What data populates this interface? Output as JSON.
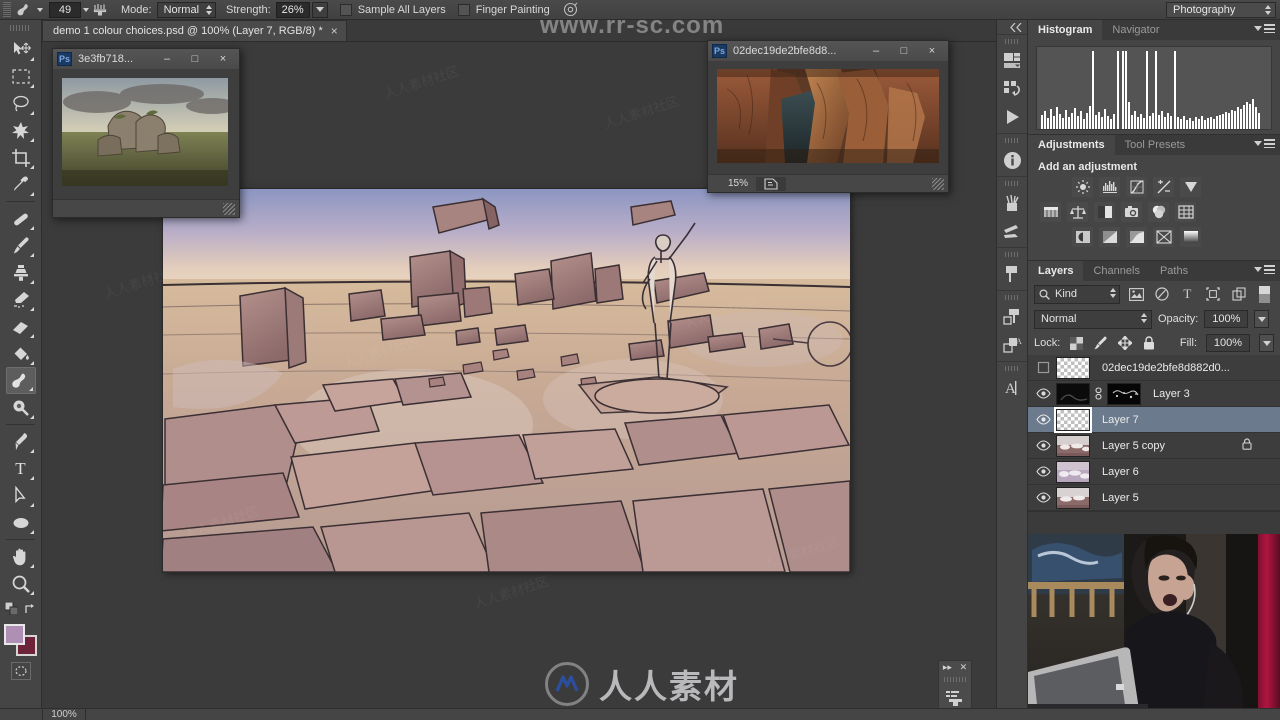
{
  "options_bar": {
    "brush_size": "49",
    "mode_label": "Mode:",
    "mode_value": "Normal",
    "strength_label": "Strength:",
    "strength_value": "26%",
    "sample_all_layers": "Sample All Layers",
    "finger_painting": "Finger Painting",
    "workspace": "Photography",
    "tool_icon": "smudge-tool-icon",
    "brush_preset_icon": "brush-preset-icon",
    "airbrush_icon": "airbrush-icon",
    "pressure_icon": "tablet-pressure-icon"
  },
  "document_tab": {
    "title": "demo 1 colour choices.psd @ 100% (Layer 7, RGB/8) *",
    "close": "×"
  },
  "toolbar": {
    "tools": [
      {
        "name": "move-tool",
        "glyph": "move"
      },
      {
        "name": "marquee-tool",
        "glyph": "marquee"
      },
      {
        "name": "lasso-tool",
        "glyph": "lasso"
      },
      {
        "name": "quick-selection-tool",
        "glyph": "wand"
      },
      {
        "name": "crop-tool",
        "glyph": "crop"
      },
      {
        "name": "eyedropper-tool",
        "glyph": "eyedropper"
      },
      {
        "name": "spot-healing-brush-tool",
        "glyph": "healing"
      },
      {
        "name": "brush-tool",
        "glyph": "brush"
      },
      {
        "name": "clone-stamp-tool",
        "glyph": "stamp"
      },
      {
        "name": "history-brush-tool",
        "glyph": "historybrush"
      },
      {
        "name": "eraser-tool",
        "glyph": "eraser"
      },
      {
        "name": "gradient-tool",
        "glyph": "paintbucket"
      },
      {
        "name": "smudge-tool",
        "glyph": "smudge",
        "selected": true
      },
      {
        "name": "dodge-tool",
        "glyph": "dodge"
      },
      {
        "name": "pen-tool",
        "glyph": "pen"
      },
      {
        "name": "type-tool",
        "glyph": "type"
      },
      {
        "name": "path-selection-tool",
        "glyph": "pathselect"
      },
      {
        "name": "ellipse-shape-tool",
        "glyph": "ellipse"
      },
      {
        "name": "hand-tool",
        "glyph": "hand"
      },
      {
        "name": "zoom-tool",
        "glyph": "zoom"
      }
    ],
    "foreground_color": "#b08fb4",
    "background_color": "#6d2338",
    "quick_mask_icon": "quick-mask-icon",
    "default_colors_icon": "default-colors-icon",
    "swap_colors_icon": "swap-colors-icon"
  },
  "float_window_left": {
    "title": "3e3fb718...",
    "app_badge": "Ps",
    "minimize": "–",
    "maximize": "□",
    "close": "×"
  },
  "float_window_right": {
    "title": "02dec19de2bfe8d8...",
    "app_badge": "Ps",
    "minimize": "–",
    "maximize": "□",
    "close": "×",
    "zoom": "15%",
    "doc_info_icon": "document-info-icon"
  },
  "dock_rail": {
    "collapse_icon": "collapse-panels-icon",
    "items": [
      {
        "name": "mini-bridge-icon"
      },
      {
        "name": "history-icon"
      },
      {
        "name": "actions-play-icon"
      },
      {
        "name": "info-icon"
      },
      {
        "name": "brush-presets-icon"
      },
      {
        "name": "tool-presets-icon"
      },
      {
        "name": "clone-source-icon"
      },
      {
        "name": "layer-comps-icon"
      },
      {
        "name": "paragraph-styles-icon"
      },
      {
        "name": "character-icon"
      }
    ]
  },
  "histogram_panel": {
    "tabs": [
      {
        "label": "Histogram",
        "active": true
      },
      {
        "label": "Navigator",
        "active": false
      }
    ],
    "menu_icon": "panel-menu-icon"
  },
  "adjustments_panel": {
    "tabs": [
      {
        "label": "Adjustments",
        "active": true
      },
      {
        "label": "Tool Presets",
        "active": false
      }
    ],
    "heading": "Add an adjustment",
    "menu_icon": "panel-menu-icon",
    "rows": [
      [
        "brightness-contrast-icon",
        "levels-icon",
        "curves-icon",
        "exposure-icon",
        "vibrance-icon"
      ],
      [
        "hue-saturation-icon",
        "color-balance-icon",
        "black-white-icon",
        "photo-filter-icon",
        "channel-mixer-icon",
        "color-lookup-icon"
      ],
      [
        "invert-icon",
        "posterize-icon",
        "threshold-icon",
        "selective-color-icon",
        "gradient-map-icon"
      ]
    ]
  },
  "layers_panel": {
    "tabs": [
      {
        "label": "Layers",
        "active": true
      },
      {
        "label": "Channels",
        "active": false
      },
      {
        "label": "Paths",
        "active": false
      }
    ],
    "menu_icon": "panel-menu-icon",
    "filter_kind": "Kind",
    "filter_icons": [
      "filter-pixel-icon",
      "filter-adjustment-icon",
      "filter-type-icon",
      "filter-shape-icon",
      "filter-smartobject-icon"
    ],
    "filter_toggle_icon": "filter-enable-toggle",
    "blend_mode": "Normal",
    "opacity_label": "Opacity:",
    "opacity_value": "100%",
    "lock_label": "Lock:",
    "lock_icons": [
      "lock-transparent-pixels-icon",
      "lock-image-pixels-icon",
      "lock-position-icon",
      "lock-all-icon"
    ],
    "fill_label": "Fill:",
    "fill_value": "100%",
    "layers": [
      {
        "name": "02dec19de2bfe8d882d0...",
        "visible": false,
        "thumb": "checker",
        "selected": false,
        "locked": false
      },
      {
        "name": "Layer 3",
        "visible": true,
        "thumb": "black",
        "mask": "black-mask",
        "linked": true,
        "selected": false,
        "locked": false
      },
      {
        "name": "Layer 7",
        "visible": true,
        "thumb": "checker",
        "selected": true,
        "locked": false
      },
      {
        "name": "Layer 5 copy",
        "visible": true,
        "thumb": "art-dark",
        "selected": false,
        "locked": true
      },
      {
        "name": "Layer 6",
        "visible": true,
        "thumb": "art-light",
        "selected": false,
        "locked": false
      },
      {
        "name": "Layer 5",
        "visible": true,
        "thumb": "art-dark",
        "selected": false,
        "locked": false
      }
    ]
  },
  "strip_close": {
    "forward_icon": "▸▸",
    "close_icon": "✕",
    "panel_icon": "measurement-log-icon"
  },
  "status_bar": {
    "zoom": "100%"
  },
  "watermarks": {
    "top_url": "www.rr-sc.com",
    "logo_text": "人人素材",
    "tile_text": "人人素材社区"
  },
  "webcam": {
    "name": "webcam-overlay"
  }
}
